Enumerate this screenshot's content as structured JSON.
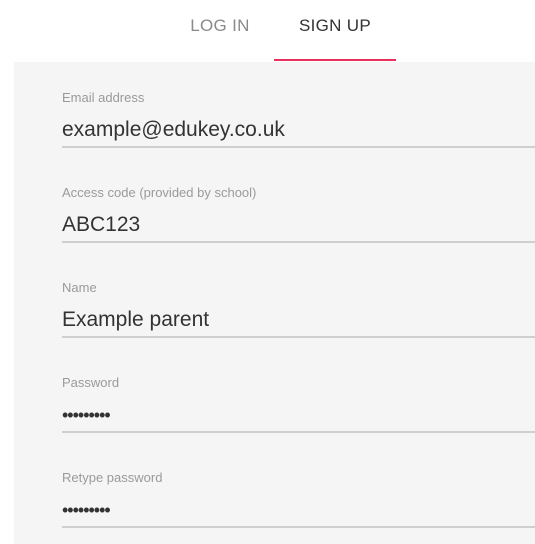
{
  "tabs": {
    "login_label": "LOG IN",
    "signup_label": "SIGN UP",
    "active": "SIGN UP",
    "accent_color": "#e8315d"
  },
  "form": {
    "email": {
      "label": "Email address",
      "value": "example@edukey.co.uk"
    },
    "access_code": {
      "label": "Access code (provided by school)",
      "value": "ABC123"
    },
    "name": {
      "label": "Name",
      "value": "Example parent"
    },
    "password": {
      "label": "Password",
      "value": "•••••••••"
    },
    "retype_password": {
      "label": "Retype password",
      "value": "•••••••••"
    }
  }
}
